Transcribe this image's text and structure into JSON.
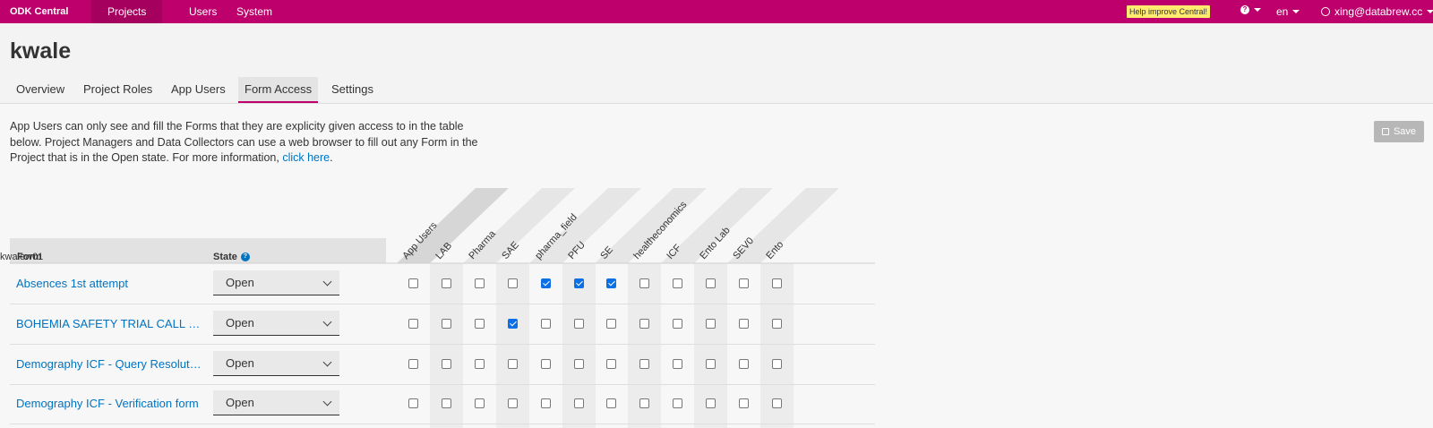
{
  "navbar": {
    "brand": "ODK Central",
    "links": [
      "Projects",
      "Users",
      "System"
    ],
    "help_badge": "Help improve Central!",
    "language": "en",
    "user": "xing@databrew.cc"
  },
  "project": {
    "title": "kwale",
    "tabs": [
      "Overview",
      "Project Roles",
      "App Users",
      "Form Access",
      "Settings"
    ],
    "active_tab": "Form Access"
  },
  "intro": {
    "text": "App Users can only see and fill the Forms that they are explicity given access to in the table below. Project Managers and Data Collectors can use a web browser to fill out any Form in the Project that is in the Open state. For more information, ",
    "link": "click here",
    "end": "."
  },
  "save_label": "Save",
  "table": {
    "col_form": "Form",
    "col_state": "State",
    "col_app_users": "App Users",
    "app_users": [
      "LAB",
      "Pharma",
      "SAE",
      "pharma_field",
      "PFU",
      "SE",
      "healtheconomics",
      "ICF",
      "Ento Lab",
      "SEV0",
      "Ento",
      "kwalew01"
    ],
    "rows": [
      {
        "form": "Absences 1st attempt",
        "state": "Open",
        "access": [
          false,
          false,
          false,
          true,
          true,
          true,
          false,
          false,
          false,
          false,
          false,
          false
        ]
      },
      {
        "form": "BOHEMIA SAFETY TRIAL CALL LOG",
        "state": "Open",
        "access": [
          false,
          false,
          true,
          false,
          false,
          false,
          false,
          false,
          false,
          false,
          false,
          false
        ]
      },
      {
        "form": "Demography ICF - Query Resolution form",
        "state": "Open",
        "access": [
          false,
          false,
          false,
          false,
          false,
          false,
          false,
          false,
          false,
          false,
          false,
          false
        ]
      },
      {
        "form": "Demography ICF - Verification form",
        "state": "Open",
        "access": [
          false,
          false,
          false,
          false,
          false,
          false,
          false,
          false,
          false,
          false,
          false,
          false
        ]
      }
    ]
  }
}
